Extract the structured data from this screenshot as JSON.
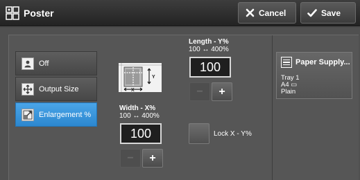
{
  "header": {
    "title": "Poster",
    "cancel_label": "Cancel",
    "save_label": "Save"
  },
  "options": [
    {
      "label": "Off",
      "icon": "person-page-icon",
      "selected": false
    },
    {
      "label": "Output Size",
      "icon": "resize-arrows-icon",
      "selected": false
    },
    {
      "label": "Enlargement %",
      "icon": "enlarge-page-icon",
      "selected": true
    }
  ],
  "illustration": {
    "y_label": "Y",
    "x_label": "X"
  },
  "length": {
    "title": "Length - Y%",
    "range": "100 ↔ 400%",
    "value": "100",
    "minus_label": "−",
    "plus_label": "+"
  },
  "width": {
    "title": "Width - X%",
    "range": "100 ↔ 400%",
    "value": "100",
    "minus_label": "−",
    "plus_label": "+"
  },
  "lock": {
    "label": "Lock X - Y%",
    "checked": false
  },
  "paper_supply": {
    "label": "Paper Supply...",
    "tray": "Tray 1",
    "size": "A4 ▭",
    "type": "Plain"
  },
  "colors": {
    "accent": "#3a98df",
    "background": "#505050",
    "titlebar": "#2c2c2c"
  }
}
